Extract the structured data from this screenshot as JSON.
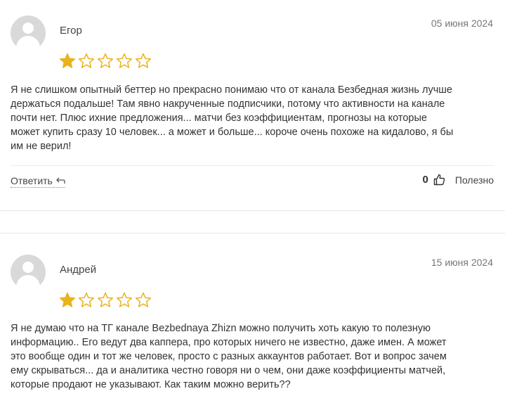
{
  "reviews": [
    {
      "author": "Егор",
      "date": "05 июня 2024",
      "rating": 1,
      "max_rating": 5,
      "text_lines": [
        "Я не слишком опытный беттер но прекрасно понимаю что от канала Безбедная жизнь лучше",
        "держаться подальше! Там явно накрученные подписчики, потому что активности на канале",
        "почти нет. Плюс ихние предложения... матчи без коэффициентам, прогнозы на которые",
        "может купить сразу 10 человек... а может и больше... короче очень похоже на кидалово, я бы",
        "им не верил!"
      ],
      "reply_label": "Ответить",
      "likes": "0",
      "helpful_label": "Полезно"
    },
    {
      "author": "Андрей",
      "date": "15 июня 2024",
      "rating": 1,
      "max_rating": 5,
      "text_lines": [
        "Я не думаю что на ТГ канале Bezbednaya Zhizn можно получить хоть какую то полезную",
        "информацию.. Его ведут два каппера, про которых ничего не известно, даже имен. А может",
        "это вообще один и тот же человек, просто с разных аккаунтов работает. Вот и вопрос зачем",
        "ему скрываться... да и аналитика честно говоря ни о чем, они даже коэффициенты матчей,",
        "которые продают не указывают. Как таким можно верить??"
      ]
    }
  ],
  "colors": {
    "star_filled": "#e9b31c",
    "star_empty_stroke": "#e9b31c",
    "avatar_bg": "#d9d9d9"
  },
  "icons": [
    "avatar-icon",
    "star-icon",
    "reply-arrow-icon",
    "thumbs-up-icon"
  ]
}
